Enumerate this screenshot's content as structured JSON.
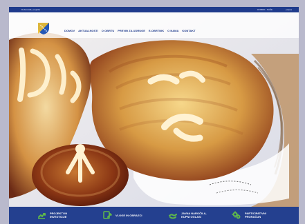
{
  "topbar": {
    "left_text": "Dobrodošli, posjetite",
    "right_text_1": "DOBRO • NAŠE",
    "right_text_2": "prijava"
  },
  "nav": {
    "items": [
      {
        "label": "DOMOV",
        "active": true
      },
      {
        "label": "AKTUALNOSTI"
      },
      {
        "label": "O OBRTU"
      },
      {
        "label": "PREVIĐ ZA UDRUGE"
      },
      {
        "label": "E-OBRTNIK"
      },
      {
        "label": "O NAMA"
      },
      {
        "label": "KONTAKT"
      }
    ]
  },
  "features": [
    {
      "label": "PROJEKTI IN\nINVESTICIJE",
      "icon": "chart-icon"
    },
    {
      "label": "VLOGE IN OBRAZCI",
      "icon": "edit-document-icon"
    },
    {
      "label": "JAVNA NAROČILA,\nKUPNI OGLASI",
      "icon": "hands-icon"
    },
    {
      "label": "PARTICIPATIVNI\nPRORAČUN",
      "icon": "gears-icon"
    }
  ],
  "colors": {
    "brand_blue": "#24408f",
    "nav_text": "#1f3b8c",
    "icon_green": "#5fb94a"
  }
}
